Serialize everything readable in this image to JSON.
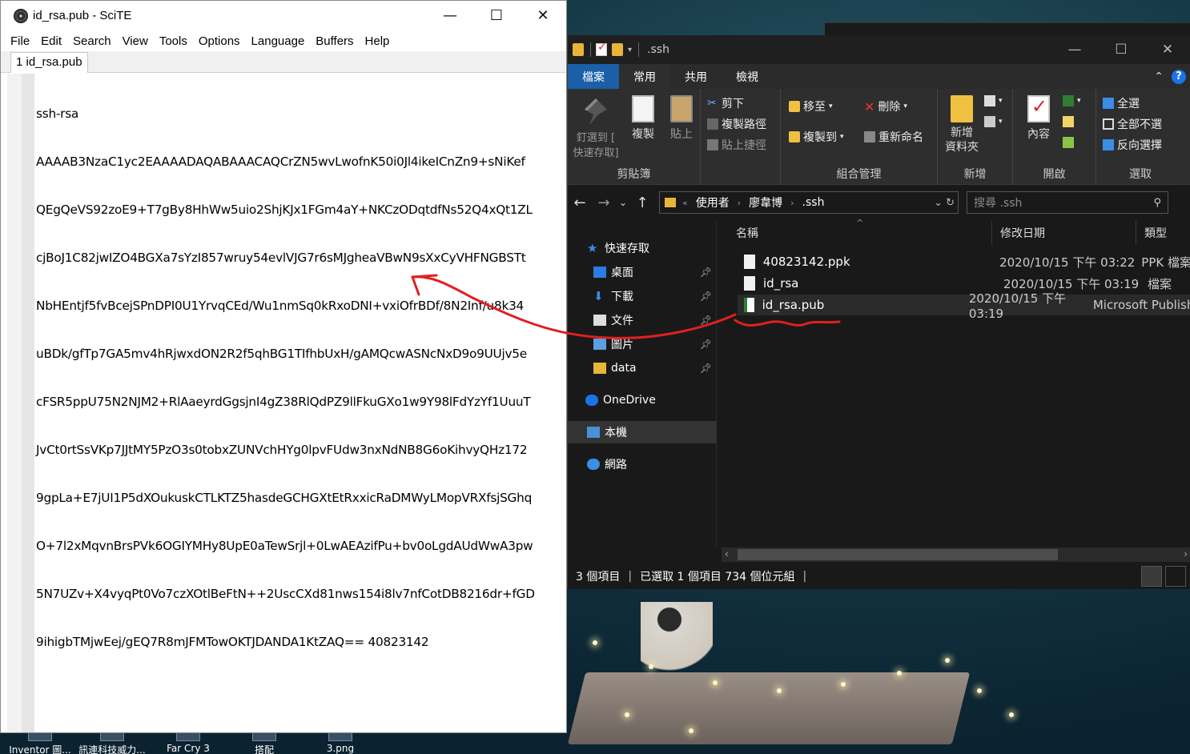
{
  "scite": {
    "title": "id_rsa.pub - SciTE",
    "menu": [
      "File",
      "Edit",
      "Search",
      "View",
      "Tools",
      "Options",
      "Language",
      "Buffers",
      "Help"
    ],
    "tab_label": "1 id_rsa.pub",
    "lines": [
      "ssh-rsa",
      "AAAAB3NzaC1yc2EAAAADAQABAAACAQCrZN5wvLwofnK50i0Jl4ikeICnZn9+sNiKef",
      "QEgQeVS92zoE9+T7gBy8HhWw5uio2ShjKJx1FGm4aY+NKCzODqtdfNs52Q4xQt1ZL",
      "cjBoJ1C82jwIZO4BGXa7sYzI857wruy54evlVJG7r6sMJgheaVBwN9sXxCyVHFNGBSTt",
      "NbHEntjf5fvBcejSPnDPI0U1YrvqCEd/Wu1nmSq0kRxoDNI+vxiOfrBDf/8N2Inf/u8k34",
      "uBDk/gfTp7GA5mv4hRjwxdON2R2f5qhBG1TIfhbUxH/gAMQcwASNcNxD9o9UUjv5e",
      "cFSR5ppU75N2NJM2+RlAaeyrdGgsjnI4gZ38RlQdPZ9llFkuGXo1w9Y98lFdYzYf1UuuT",
      "JvCt0rtSsVKp7JJtMY5PzO3s0tobxZUNVchHYg0lpvFUdw3nxNdNB8G6oKihvyQHz172",
      "9gpLa+E7jUI1P5dXOukuskCTLKTZ5hasdeGCHGXtEtRxxicRaDMWyLMopVRXfsjSGhq",
      "O+7l2xMqvnBrsPVk6OGIYMHy8UpE0aTewSrjl+0LwAEAzifPu+bv0oLgdAUdWwA3pw",
      "5N7UZv+X4vyqPt0Vo7czXOtlBeFtN++2UscCXd81nws154i8lv7nfCotDB8216dr+fGD",
      "9ihigbTMjwEej/gEQ7R8mJFMTowOKTJDANDA1KtZAQ== 40823142"
    ]
  },
  "explorer": {
    "title": ".ssh",
    "ribbon_tabs": [
      "檔案",
      "常用",
      "共用",
      "檢視"
    ],
    "groups": {
      "clipboard": {
        "label": "剪貼簿",
        "pin": "釘選到 [\n快速存取]",
        "copy": "複製",
        "paste": "貼上",
        "cut": "剪下",
        "copy_path": "複製路徑",
        "paste_shortcut": "貼上捷徑"
      },
      "organize": {
        "label": "組合管理",
        "move_to": "移至",
        "copy_to": "複製到",
        "delete": "刪除",
        "rename": "重新命名"
      },
      "new": {
        "label": "新增",
        "new_folder": "新增\n資料夾"
      },
      "open": {
        "label": "開啟",
        "properties": "內容"
      },
      "select": {
        "label": "選取",
        "select_all": "全選",
        "select_none": "全部不選",
        "invert": "反向選擇"
      }
    },
    "address": {
      "parts": [
        "使用者",
        "廖韋博",
        ".ssh"
      ]
    },
    "search_placeholder": "搜尋 .ssh",
    "sidebar": [
      {
        "label": "快速存取",
        "icon": "star-icon"
      },
      {
        "label": "桌面",
        "icon": "desktop-icon",
        "pinned": true
      },
      {
        "label": "下載",
        "icon": "download-icon",
        "pinned": true
      },
      {
        "label": "文件",
        "icon": "document-icon",
        "pinned": true
      },
      {
        "label": "圖片",
        "icon": "pictures-icon",
        "pinned": true
      },
      {
        "label": "data",
        "icon": "folder-icon",
        "pinned": true
      },
      {
        "label": "OneDrive",
        "icon": "cloud-icon"
      },
      {
        "label": "本機",
        "icon": "computer-icon"
      },
      {
        "label": "網路",
        "icon": "network-icon"
      }
    ],
    "columns": [
      "名稱",
      "修改日期",
      "類型"
    ],
    "files": [
      {
        "name": "40823142.ppk",
        "date": "2020/10/15 下午 03:22",
        "type": "PPK 檔案"
      },
      {
        "name": "id_rsa",
        "date": "2020/10/15 下午 03:19",
        "type": "檔案"
      },
      {
        "name": "id_rsa.pub",
        "date": "2020/10/15 下午 03:19",
        "type": "Microsoft Publisher"
      }
    ],
    "status": {
      "count": "3 個項目",
      "selected": "已選取 1 個項目  734 個位元組"
    }
  },
  "desktop": {
    "icons": [
      "Inventor 圖...",
      "訊連科技威力...",
      "Far Cry 3",
      "搭配",
      "3.png"
    ]
  },
  "colors": {
    "annotation": "#e02020",
    "explorer_bg": "#191919",
    "file_tab": "#1a5fa8"
  }
}
